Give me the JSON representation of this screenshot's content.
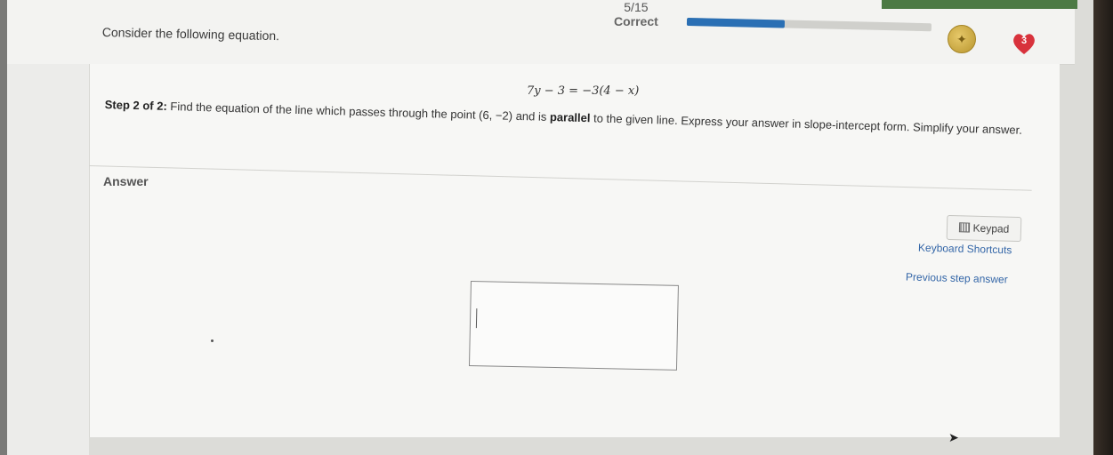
{
  "header": {
    "intro_text": "Consider the following equation.",
    "score_fraction": "5/15",
    "score_label": "Correct",
    "progress_fraction": 0.4,
    "coin_icon": "coin-icon",
    "heart_count": "3"
  },
  "problem": {
    "equation": "7y − 3 = −3(4 − x)",
    "step_prefix": "Step 2 of 2:",
    "step_text_1": " Find the equation of the line which passes through the point (6, −2) and is ",
    "step_bold": "parallel",
    "step_text_2": " to the given line. Express your answer in slope-intercept form. Simplify your answer."
  },
  "answer": {
    "label": "Answer",
    "input_value": "",
    "input_placeholder": ""
  },
  "tools": {
    "keypad_label": "Keypad",
    "shortcuts_label": "Keyboard Shortcuts",
    "previous_step_label": "Previous step answer"
  },
  "colors": {
    "progress": "#2a6fb4",
    "heart": "#d8323c",
    "link": "#3567a8"
  }
}
